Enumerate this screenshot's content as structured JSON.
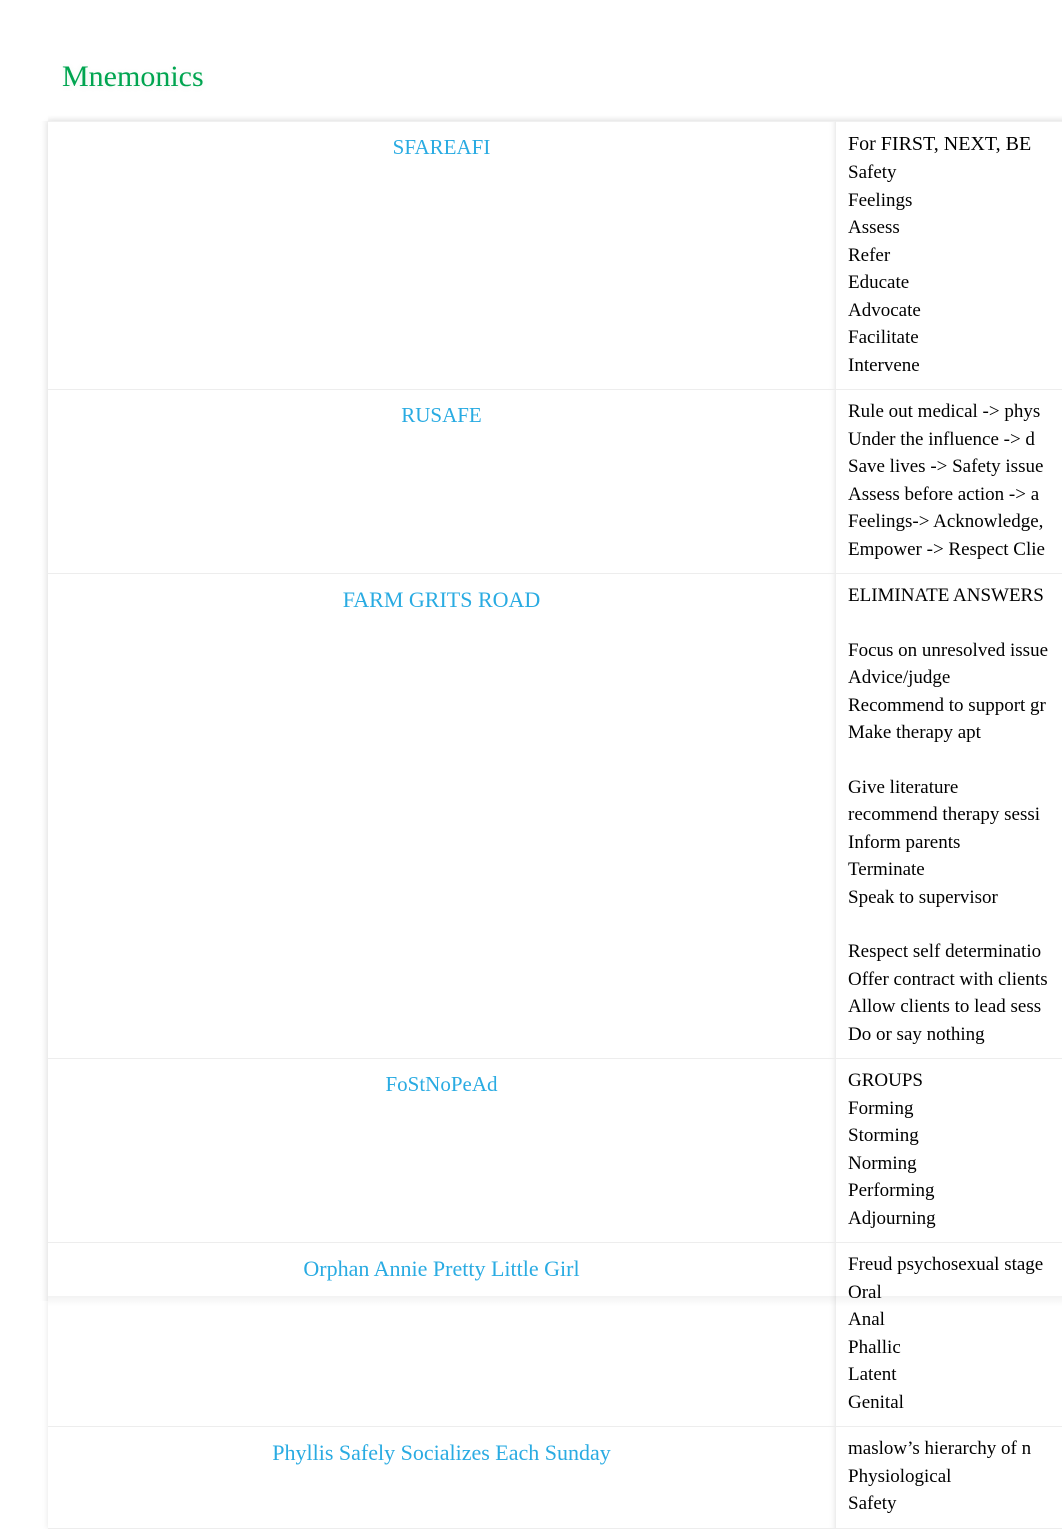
{
  "document": {
    "title": "Mnemonics",
    "title_color": "#00A550",
    "key_color": "#29ABE2",
    "value_color": "#000000"
  },
  "table": {
    "rows": [
      {
        "key": "SFAREAFI",
        "lines": [
          {
            "text": "For FIRST, NEXT, BE",
            "style": "lead"
          },
          {
            "text": "Safety",
            "style": "normal"
          },
          {
            "text": "Feelings",
            "style": "normal"
          },
          {
            "text": "Assess",
            "style": "normal"
          },
          {
            "text": "Refer",
            "style": "normal"
          },
          {
            "text": "Educate",
            "style": "normal"
          },
          {
            "text": "Advocate",
            "style": "normal"
          },
          {
            "text": "Facilitate",
            "style": "normal"
          },
          {
            "text": "Intervene",
            "style": "normal"
          }
        ]
      },
      {
        "key": "RUSAFE",
        "lines": [
          {
            "text": "Rule out medical  -> phys",
            "style": "normal"
          },
          {
            "text": "Under the influence  -> d",
            "style": "normal"
          },
          {
            "text": "Save lives -> Safety issue",
            "style": "normal"
          },
          {
            "text": "Assess before action  -> a",
            "style": "normal"
          },
          {
            "text": "Feelings-> Acknowledge,",
            "style": "normal"
          },
          {
            "text": "Empower  -> Respect Clie",
            "style": "normal"
          }
        ]
      },
      {
        "key": "FARM GRITS ROAD",
        "lines": [
          {
            "text": "ELIMINATE ANSWERS",
            "style": "normal"
          },
          {
            "text": "",
            "style": "spacer"
          },
          {
            "text": "Focus on unresolved issue",
            "style": "normal"
          },
          {
            "text": "Advice/judge",
            "style": "normal"
          },
          {
            "text": "Recommend to support gr",
            "style": "normal"
          },
          {
            "text": "Make therapy apt",
            "style": "normal"
          },
          {
            "text": "",
            "style": "spacer"
          },
          {
            "text": "Give literature",
            "style": "normal"
          },
          {
            "text": "recommend therapy sessi",
            "style": "normal"
          },
          {
            "text": "Inform parents",
            "style": "normal"
          },
          {
            "text": "Terminate",
            "style": "normal"
          },
          {
            "text": "Speak to supervisor",
            "style": "normal"
          },
          {
            "text": "",
            "style": "spacer"
          },
          {
            "text": "Respect self determinatio",
            "style": "normal"
          },
          {
            "text": "Offer contract with clients",
            "style": "normal"
          },
          {
            "text": "Allow clients to lead sess",
            "style": "normal"
          },
          {
            "text": "Do or say nothing",
            "style": "normal"
          }
        ]
      },
      {
        "key": "FoStNoPeAd",
        "lines": [
          {
            "text": "GROUPS",
            "style": "normal"
          },
          {
            "text": "Forming",
            "style": "normal"
          },
          {
            "text": "Storming",
            "style": "normal"
          },
          {
            "text": "Norming",
            "style": "normal"
          },
          {
            "text": "Performing",
            "style": "normal"
          },
          {
            "text": "Adjourning",
            "style": "normal"
          }
        ]
      },
      {
        "key": "Orphan Annie Pretty Little Girl",
        "lines": [
          {
            "text": "Freud psychosexual stage",
            "style": "normal"
          },
          {
            "text": "Oral",
            "style": "normal"
          },
          {
            "text": "Anal",
            "style": "normal"
          },
          {
            "text": "Phallic",
            "style": "normal"
          },
          {
            "text": "Latent",
            "style": "normal"
          },
          {
            "text": "Genital",
            "style": "normal"
          }
        ]
      },
      {
        "key": "Phyllis Safely Socializes Each Sunday",
        "lines": [
          {
            "text": "maslow’s hierarchy of n",
            "style": "normal"
          },
          {
            "text": "Physiological",
            "style": "normal"
          },
          {
            "text": "Safety",
            "style": "normal"
          }
        ]
      }
    ]
  }
}
